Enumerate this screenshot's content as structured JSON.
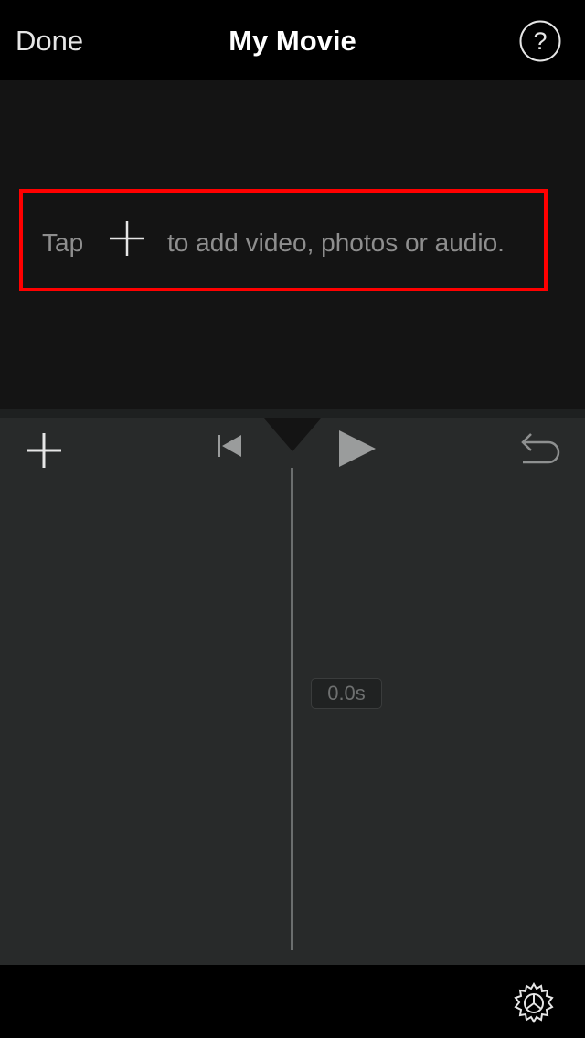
{
  "nav": {
    "done_label": "Done",
    "title": "My Movie",
    "help_icon": "question-mark-circle-icon"
  },
  "viewer": {
    "hint_prefix": "Tap",
    "hint_suffix": "to add video, photos or audio.",
    "hint_icon": "plus-icon",
    "highlight_color": "#ff0000"
  },
  "toolbar": {
    "add_icon": "plus-icon",
    "rewind_icon": "skip-to-start-icon",
    "play_icon": "play-icon",
    "undo_icon": "undo-icon"
  },
  "timeline": {
    "duration": "0.0s"
  },
  "bottom": {
    "settings_icon": "gear-icon"
  }
}
